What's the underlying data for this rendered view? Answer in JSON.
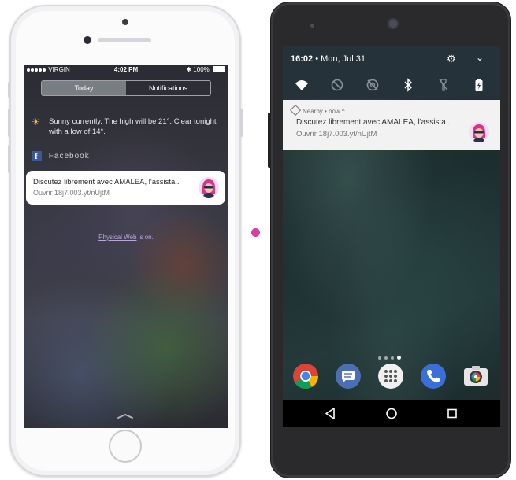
{
  "colors": {
    "facebook_blue": "#3b5998",
    "accent_pink": "#d6409a",
    "android_qs_bg": "#26323a",
    "notification_bg": "#f2f2f2"
  },
  "ios": {
    "status": {
      "carrier": "VIRGIN",
      "time": "4:02 PM",
      "battery": "100%"
    },
    "tabs": [
      {
        "label": "Today",
        "active": true
      },
      {
        "label": "Notifications",
        "active": false
      }
    ],
    "weather": {
      "icon": "sun-icon",
      "text": "Sunny currently. The high will be 21°. Clear tonight with a low of 14°."
    },
    "facebook": {
      "icon": "facebook-logo-icon",
      "label": "Facebook"
    },
    "notification": {
      "title": "Discutez librement avec AMALEA, l'assista..",
      "subtitle": "Ouvrir 18j7.003.yt/nUjtM",
      "icon": "amalea-avatar-icon"
    },
    "physical_web": {
      "link": "Physical Web",
      "suffix": " is on."
    }
  },
  "android": {
    "quick_settings": {
      "time": "16:02",
      "separator": "•",
      "date": "Mon, Jul 31",
      "icons": [
        "wifi-icon",
        "do-not-disturb-icon",
        "location-off-icon",
        "bluetooth-icon",
        "flashlight-icon",
        "battery-icon"
      ]
    },
    "notification": {
      "source": "Nearby • now ^",
      "title": "Discutez librement avec AMALEA, l'assista..",
      "subtitle": "Ouvrir 18j7.003.yt/nUjtM",
      "icon": "amalea-avatar-icon"
    },
    "dock": [
      "chrome-icon",
      "messages-icon",
      "app-drawer-icon",
      "phone-icon",
      "camera-icon"
    ],
    "nav": [
      "back-icon",
      "home-icon",
      "recents-icon"
    ]
  }
}
